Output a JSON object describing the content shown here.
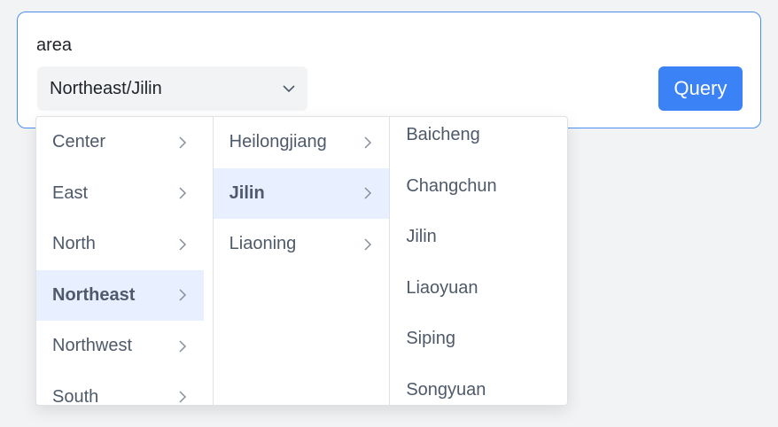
{
  "form": {
    "label": "area",
    "select_value": "Northeast/Jilin",
    "query_label": "Query"
  },
  "cascader": {
    "regions": [
      {
        "label": "Center",
        "active": false
      },
      {
        "label": "East",
        "active": false
      },
      {
        "label": "North",
        "active": false
      },
      {
        "label": "Northeast",
        "active": true
      },
      {
        "label": "Northwest",
        "active": false
      },
      {
        "label": "South",
        "active": false
      }
    ],
    "provinces": [
      {
        "label": "Heilongjiang",
        "active": false
      },
      {
        "label": "Jilin",
        "active": true
      },
      {
        "label": "Liaoning",
        "active": false
      }
    ],
    "cities": [
      "Baicheng",
      "Changchun",
      "Jilin",
      "Liaoyuan",
      "Siping",
      "Songyuan"
    ]
  },
  "icons": {
    "select_indicator": "chevron-down-icon",
    "item_indicator": "chevron-right-icon"
  },
  "colors": {
    "accent": "#3b82f6",
    "border_focus": "#4a90f2",
    "active_bg": "#e8efff"
  }
}
